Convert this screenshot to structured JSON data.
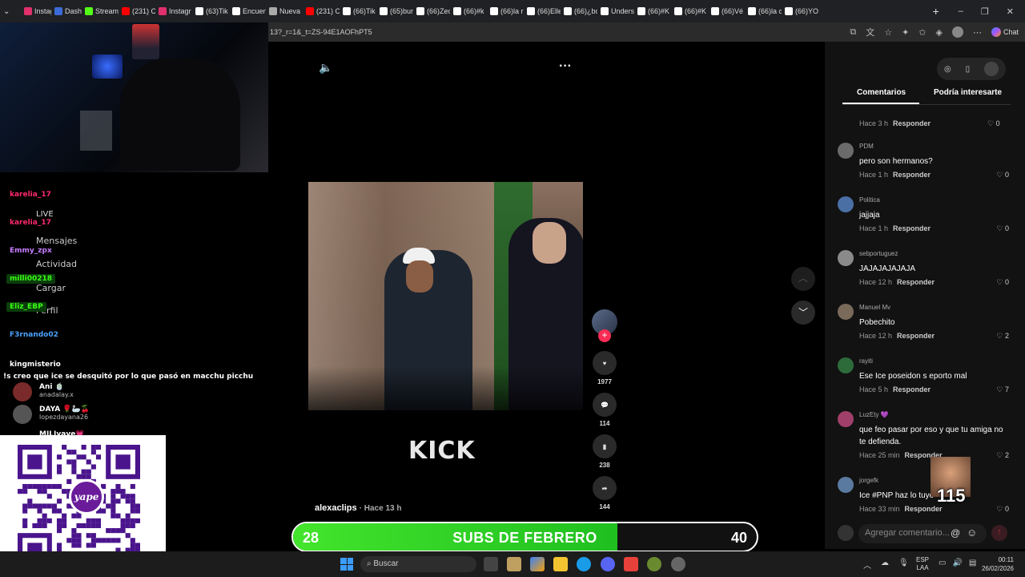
{
  "browser": {
    "tabs": [
      {
        "label": "Instagra",
        "color": "#e1306c"
      },
      {
        "label": "Dashboa",
        "color": "#3b6bd6"
      },
      {
        "label": "Stream",
        "color": "#53fc18"
      },
      {
        "label": "(231) C",
        "color": "#ff0000"
      },
      {
        "label": "Instagr",
        "color": "#e1306c"
      },
      {
        "label": "(63)Tik",
        "color": "#ffffff"
      },
      {
        "label": "Encuen",
        "color": "#ffffff"
      },
      {
        "label": "Nueva",
        "color": "#aaaaaa"
      },
      {
        "label": "(231) C",
        "color": "#ff0000"
      },
      {
        "label": "(66)Tik",
        "color": "#ffffff"
      },
      {
        "label": "(65)bur",
        "color": "#ffffff"
      },
      {
        "label": "(66)Zec",
        "color": "#ffffff"
      },
      {
        "label": "(66)#k",
        "color": "#ffffff"
      },
      {
        "label": "(66)la r",
        "color": "#ffffff"
      },
      {
        "label": "(66)Elle",
        "color": "#ffffff"
      },
      {
        "label": "(66)¿bc",
        "color": "#ffffff"
      },
      {
        "label": "Unders",
        "color": "#ffffff"
      },
      {
        "label": "(66)#K",
        "color": "#ffffff"
      },
      {
        "label": "(66)#K",
        "color": "#ffffff"
      },
      {
        "label": "(66)Vé",
        "color": "#ffffff"
      },
      {
        "label": "(66)la c",
        "color": "#ffffff"
      },
      {
        "label": "(66)YO",
        "color": "#ffffff"
      }
    ],
    "url": "13?_r=1&_t=ZS-94E1AOFhPT5",
    "copilot_label": "Chat"
  },
  "overlay": {
    "chat": [
      {
        "user": "karelia_17",
        "color": "#ff2a6d"
      },
      {
        "user": "karelia_17",
        "color": "#ff2a6d"
      },
      {
        "user": "Emmy_zpx",
        "color": "#c77dff"
      },
      {
        "user": "milli00218",
        "color": "#39ff14"
      },
      {
        "user": "Eliz_EBP",
        "color": "#39ff14"
      },
      {
        "user": "F3rnando02",
        "color": "#4aa3ff"
      },
      {
        "user": "kingmisterio",
        "color": "#ffffff"
      }
    ],
    "message": "!s creo que ice se desquitó por lo que pasó en macchu picchu",
    "menu": [
      "LIVE",
      "Mensajes",
      "Actividad",
      "Cargar",
      "Perfil"
    ],
    "viewers": [
      {
        "name": "Ani 🍵",
        "handle": "anadalay.x"
      },
      {
        "name": "DAYA 🌹🦢🍒",
        "handle": "lopezdayana26"
      },
      {
        "name": "MILIyave💗",
        "handle": ""
      }
    ],
    "qr_brand": "yape"
  },
  "video": {
    "watermark": "KICK",
    "author": "alexaclips",
    "time": "· Hace 13 h",
    "likes": "1977",
    "comments": "114",
    "saves": "238",
    "shares": "144"
  },
  "comments_panel": {
    "tab_comments": "Comentarios",
    "tab_interest": "Podría interesarte",
    "first_meta": {
      "time": "Hace 3 h",
      "reply": "Responder",
      "likes": "0"
    },
    "items": [
      {
        "user": "PDM",
        "text": "pero son hermanos?",
        "time": "Hace 1 h",
        "reply": "Responder",
        "likes": "0",
        "avatar": "#6b6b6b"
      },
      {
        "user": "Politica",
        "text": "jajjaja",
        "time": "Hace 1 h",
        "reply": "Responder",
        "likes": "0",
        "avatar": "#4a6fa5"
      },
      {
        "user": "sebportuguez",
        "text": "JAJAJAJAJAJA",
        "time": "Hace 12 h",
        "reply": "Responder",
        "likes": "0",
        "avatar": "#8a8a8a"
      },
      {
        "user": "Manuel Mv",
        "text": "Pobechito",
        "time": "Hace 12 h",
        "reply": "Responder",
        "likes": "2",
        "avatar": "#7a6a5a"
      },
      {
        "user": "rayiti",
        "text": "Ese Ice poseidon s eporto mal",
        "time": "Hace 5 h",
        "reply": "Responder",
        "likes": "7",
        "avatar": "#2e6b3a"
      },
      {
        "user": "LuzEty 💜",
        "text": "que feo pasar por eso y que tu amiga no te defienda.",
        "time": "Hace 25 min",
        "reply": "Responder",
        "likes": "2",
        "avatar": "#a0406a"
      },
      {
        "user": "jorgefk",
        "text": "Ice #PNP haz lo tuyo",
        "time": "Hace 33 min",
        "reply": "Responder",
        "likes": "0",
        "avatar": "#5a7aa0"
      }
    ],
    "input_placeholder": "Agregar comentario..."
  },
  "emote_count": "115",
  "subs_goal": {
    "title": "SUBS DE FEBRERO",
    "current": "28",
    "target": "40",
    "progress": 0.7
  },
  "taskbar": {
    "search": "Buscar",
    "lang": "ESP",
    "lang2": "LAA",
    "time": "00:11",
    "date": "26/02/2026"
  }
}
